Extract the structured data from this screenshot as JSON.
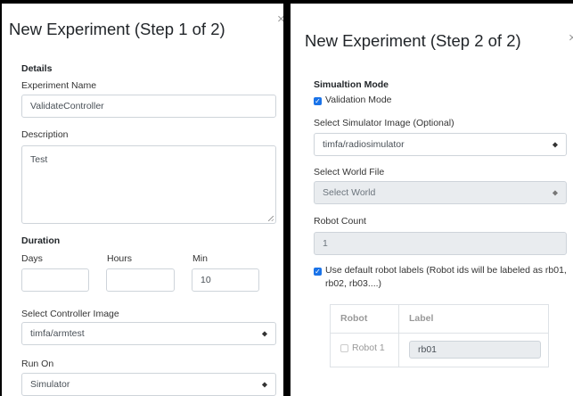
{
  "step1": {
    "title": "New Experiment (Step 1 of 2)",
    "close": "×",
    "details_heading": "Details",
    "experiment_name_label": "Experiment Name",
    "experiment_name_value": "ValidateController",
    "description_label": "Description",
    "description_value": "Test",
    "duration_heading": "Duration",
    "days_label": "Days",
    "hours_label": "Hours",
    "min_label": "Min",
    "days_value": "",
    "hours_value": "",
    "min_value": "10",
    "controller_image_label": "Select Controller Image",
    "controller_image_value": "timfa/armtest",
    "run_on_label": "Run On",
    "run_on_value": "Simulator"
  },
  "step2": {
    "title": "New Experiment (Step 2 of 2)",
    "close": "×",
    "mode_heading": "Simualtion Mode",
    "validation_mode_label": "Validation Mode",
    "validation_mode_checked": true,
    "sim_image_label": "Select Simulator Image (Optional)",
    "sim_image_value": "timfa/radiosimulator",
    "world_file_label": "Select World File",
    "world_file_value": "Select World",
    "robot_count_label": "Robot Count",
    "robot_count_value": "1",
    "default_labels_text": "Use default robot labels (Robot ids will be labeled as rb01, rb02, rb03....)",
    "default_labels_checked": true,
    "table": {
      "col_robot": "Robot",
      "col_label": "Label",
      "rows": [
        {
          "robot": "Robot 1",
          "label": "rb01"
        }
      ]
    }
  },
  "colors": {
    "accent": "#1a73e8",
    "border": "#ced4da",
    "disabled_bg": "#e9ecef"
  },
  "icons": {
    "close": "close-icon",
    "select_arrow": "chevron-updown-icon",
    "check": "checkbox-icon"
  }
}
